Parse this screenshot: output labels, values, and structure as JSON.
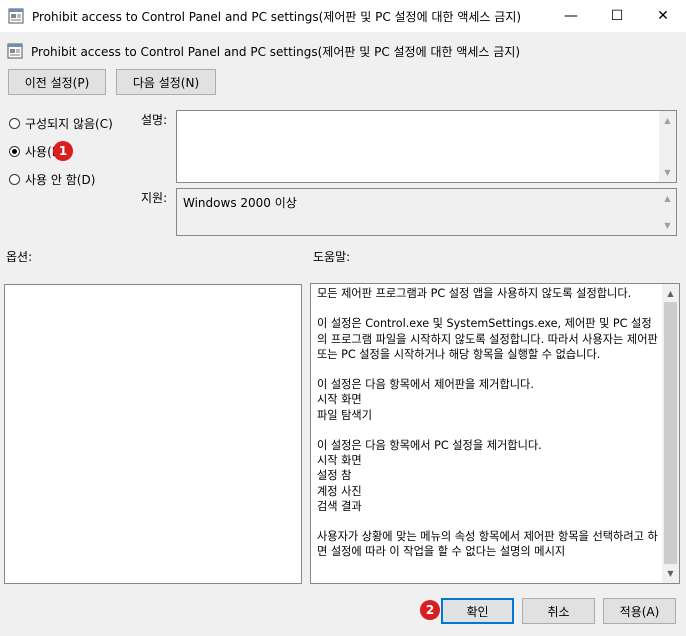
{
  "window": {
    "title": "Prohibit access to Control Panel and PC settings(제어판 및 PC 설정에 대한 액세스 금지)",
    "controls": {
      "minimize": "—",
      "maximize": "☐",
      "close": "✕"
    }
  },
  "header": {
    "policy_name": "Prohibit access to Control Panel and PC settings(제어판 및 PC 설정에 대한 액세스 금지)"
  },
  "nav": {
    "prev_label": "이전 설정(P)",
    "next_label": "다음 설정(N)"
  },
  "options": {
    "not_configured": "구성되지 않음(C)",
    "enabled": "사용(E)",
    "disabled": "사용 안 함(D)",
    "selected": "enabled"
  },
  "comment_label": "설명:",
  "supported_label": "지원:",
  "supported_value": "Windows 2000 이상",
  "options_label": "옵션:",
  "help_label": "도움말:",
  "help_text": "모든 제어판 프로그램과 PC 설정 앱을 사용하지 않도록 설정합니다.\n\n이 설정은 Control.exe 및 SystemSettings.exe, 제어판 및 PC 설정의 프로그램 파일을 시작하지 않도록 설정합니다. 따라서 사용자는 제어판 또는 PC 설정을 시작하거나 해당 항목을 실행할 수 없습니다.\n\n이 설정은 다음 항목에서 제어판을 제거합니다.\n시작 화면\n파일 탐색기\n\n이 설정은 다음 항목에서 PC 설정을 제거합니다.\n시작 화면\n설정 참\n계정 사진\n검색 결과\n\n사용자가 상황에 맞는 메뉴의 속성 항목에서 제어판 항목을 선택하려고 하면 설정에 따라 이 작업을 할 수 없다는 설명의 메시지",
  "buttons": {
    "ok": "확인",
    "cancel": "취소",
    "apply": "적용(A)"
  },
  "badges": {
    "one": "1",
    "two": "2"
  }
}
